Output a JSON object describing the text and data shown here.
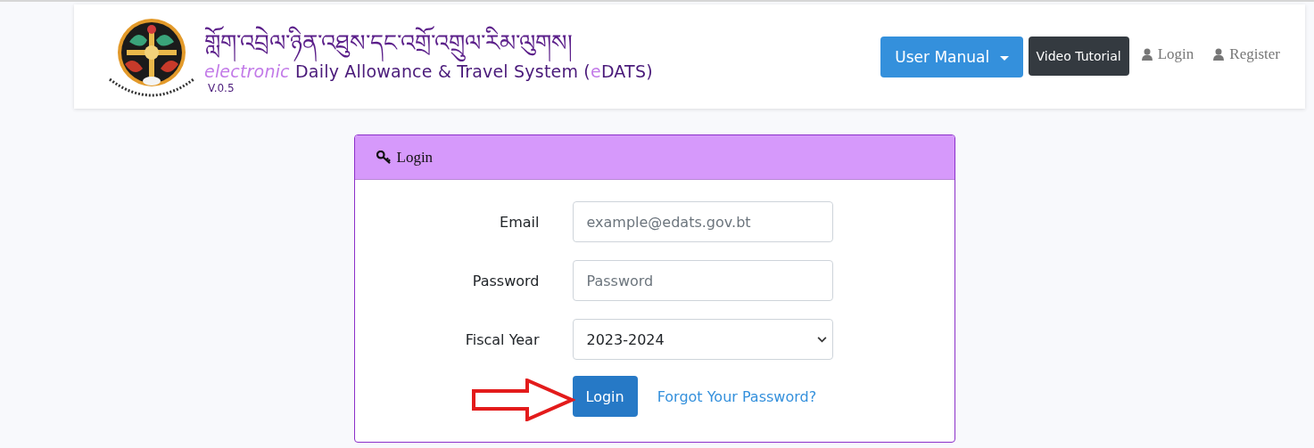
{
  "header": {
    "tibetan_title": "གློག་འབྲེལ་ཉིན་འཐུས་དང་འགྲོ་འགྲུལ་རིམ་ལུགས།",
    "title_parts": [
      {
        "text": "electronic",
        "accent": true,
        "italic": true
      },
      {
        "text": " Daily Allowance & Travel System (",
        "accent": false,
        "italic": false
      },
      {
        "text": "e",
        "accent": true,
        "italic": false
      },
      {
        "text": "DATS)",
        "accent": false,
        "italic": false
      }
    ],
    "version": "V.0.5",
    "nav": [
      {
        "label": "User Manual",
        "kind": "dropdown"
      },
      {
        "label": "Video Tutorial",
        "kind": "dark"
      },
      {
        "label": "Login",
        "kind": "link"
      },
      {
        "label": "Register",
        "kind": "link"
      }
    ]
  },
  "login_card": {
    "title": "Login",
    "fields": [
      {
        "label": "Email",
        "kind": "input",
        "placeholder": "example@edats.gov.bt"
      },
      {
        "label": "Password",
        "kind": "input",
        "placeholder": "Password"
      },
      {
        "label": "Fiscal Year",
        "kind": "select",
        "value": "2023-2024"
      }
    ],
    "submit": "Login",
    "forgot_link": "Forgot Your Password?"
  }
}
